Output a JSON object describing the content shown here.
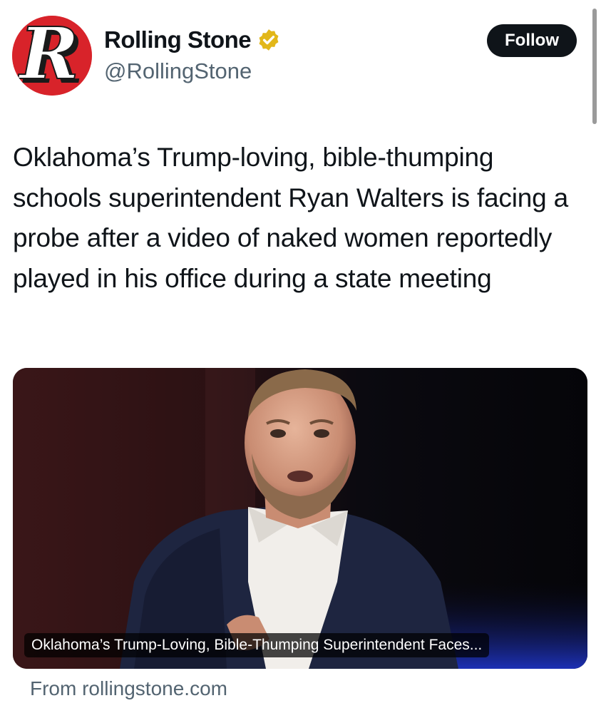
{
  "header": {
    "display_name": "Rolling Stone",
    "handle": "@RollingStone",
    "avatar_letter": "R",
    "verified_badge_color": "#e2b719",
    "follow_label": "Follow"
  },
  "tweet": {
    "text": "Oklahoma’s Trump-loving, bible-thumping schools superintendent Ryan Walters is facing a probe after a video of naked women reportedly played in his office during a state meeting"
  },
  "link_card": {
    "image_subject": "man in dark suit and white shirt speaking",
    "headline": "Oklahoma’s Trump-Loving, Bible-Thumping Superintendent Faces...",
    "source": "From rollingstone.com"
  },
  "colors": {
    "text_primary": "#0f1419",
    "text_secondary": "#536471",
    "brand_red": "#d8232a",
    "follow_bg": "#0f1419"
  }
}
